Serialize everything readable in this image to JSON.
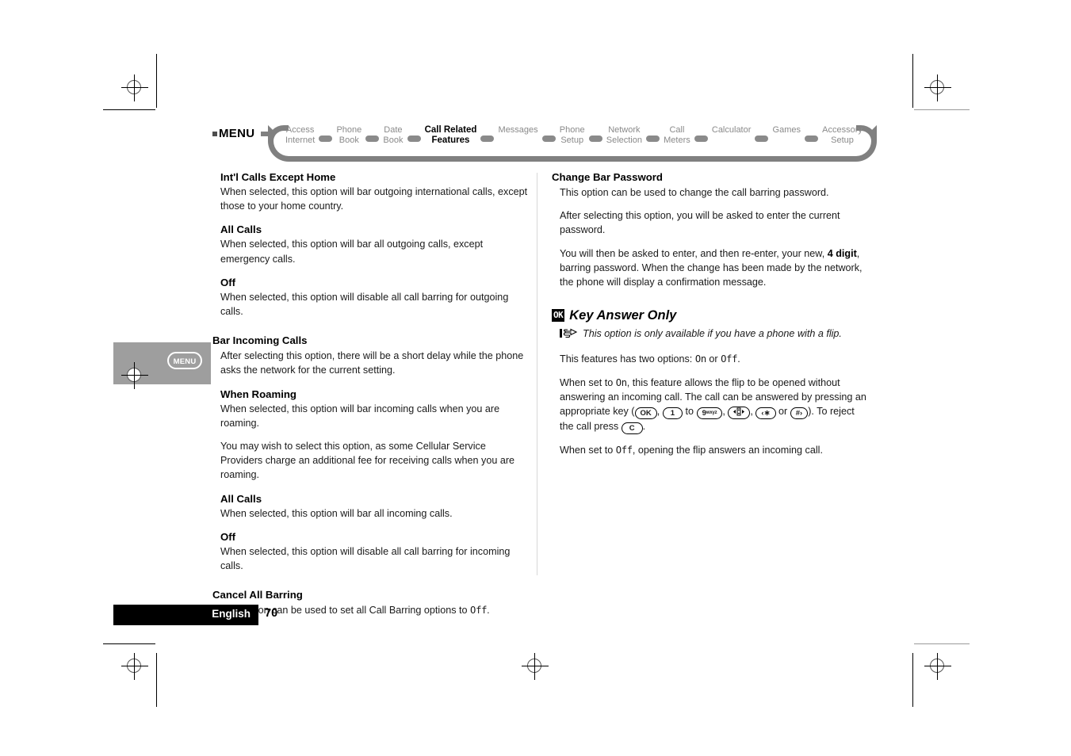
{
  "menubar": {
    "menu_label": "MENU",
    "items": [
      {
        "label": "Access\nInternet",
        "active": false
      },
      {
        "label": "Phone\nBook",
        "active": false
      },
      {
        "label": "Date\nBook",
        "active": false
      },
      {
        "label": "Call Related\nFeatures",
        "active": true
      },
      {
        "label": "Messages",
        "active": false
      },
      {
        "label": "Phone\nSetup",
        "active": false
      },
      {
        "label": "Network\nSelection",
        "active": false
      },
      {
        "label": "Call\nMeters",
        "active": false
      },
      {
        "label": "Calculator",
        "active": false
      },
      {
        "label": "Games",
        "active": false
      },
      {
        "label": "Accessory\nSetup",
        "active": false
      }
    ]
  },
  "side_tab": {
    "menu_key_label": "MENU"
  },
  "left_column": {
    "sections": [
      {
        "heading": "Int'l Calls Except Home",
        "heading_level": "sub",
        "paragraphs": [
          "When selected, this option will bar outgoing international calls, except those to your home country."
        ]
      },
      {
        "heading": "All Calls",
        "heading_level": "sub",
        "paragraphs": [
          "When selected, this option will bar all outgoing calls, except emergency calls."
        ]
      },
      {
        "heading": "Off",
        "heading_level": "sub",
        "paragraphs": [
          "When selected, this option will disable all call barring for outgoing calls."
        ]
      },
      {
        "heading": "Bar Incoming Calls",
        "heading_level": "section",
        "paragraphs": [
          "After selecting this option, there will be a short delay while the phone asks the network for the current setting."
        ]
      },
      {
        "heading": "When Roaming",
        "heading_level": "sub",
        "paragraphs": [
          "When selected, this option will bar incoming calls when you are roaming.",
          "You may wish to select this option, as some Cellular Service Providers charge an additional fee for receiving calls when you are roaming."
        ]
      },
      {
        "heading": "All Calls",
        "heading_level": "sub",
        "paragraphs": [
          "When selected, this option will bar all incoming calls."
        ]
      },
      {
        "heading": "Off",
        "heading_level": "sub",
        "paragraphs": [
          "When selected, this option will disable all call barring for incoming calls."
        ]
      }
    ],
    "cancel_all_barring": {
      "heading": "Cancel All Barring",
      "text_before": "This option can be used to set all Call Barring options to ",
      "lcd_value": "Off",
      "text_after": "."
    }
  },
  "right_column": {
    "change_bar_password": {
      "heading": "Change Bar Password",
      "paragraph_1": "This option can be used to change the call barring password.",
      "paragraph_2": "After selecting this option, you will be asked to enter the current password.",
      "paragraph_3_a": "You will then be asked to enter, and then re-enter, your new, ",
      "paragraph_3_bold": "4 digit",
      "paragraph_3_b": ", barring password. When the change has been made by the network, the phone will display a confirmation message."
    },
    "key_answer_only": {
      "badge": "OK",
      "heading": "Key Answer Only",
      "note": "This option is only available if you have a phone with a flip.",
      "options_before": "This features has two options: ",
      "option_on": "On",
      "options_middle": " or ",
      "option_off": "Off",
      "options_after": ".",
      "on_para_a": "When set to ",
      "on_para_on": "On",
      "on_para_b": ", this feature allows the flip to be opened without answering an incoming call. The call can be answered by pressing an appropriate key (",
      "keys": [
        {
          "name": "ok-key",
          "label": "OK",
          "sup": ""
        },
        {
          "name": "one-key",
          "label": "1",
          "sup": ""
        },
        {
          "name": "nine-key",
          "label": "9",
          "sup": "wxyz"
        },
        {
          "name": "nav-key",
          "label": "nav",
          "sup": ""
        },
        {
          "name": "star-key",
          "label": "‹∗",
          "sup": ""
        },
        {
          "name": "pound-key",
          "label": "#›",
          "sup": ""
        }
      ],
      "key_sep_to": " to ",
      "key_sep_comma": ", ",
      "key_sep_or": " or ",
      "on_para_c": "). To reject the call press ",
      "c_key_label": "C",
      "on_para_d": ".",
      "off_para_a": "When set to ",
      "off_para_off": "Off",
      "off_para_b": ", opening the flip answers an incoming call."
    }
  },
  "footer": {
    "language": "English",
    "page_number": "70"
  }
}
